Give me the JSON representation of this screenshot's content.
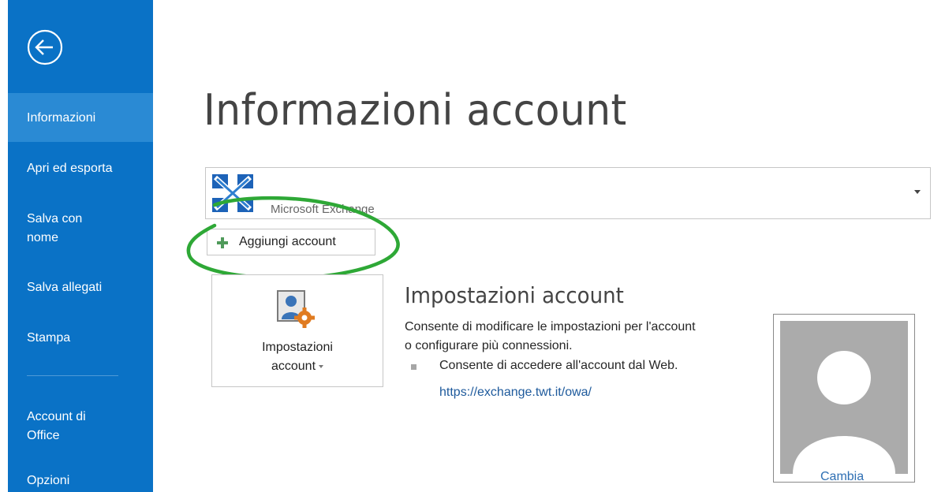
{
  "sidebar": {
    "back_icon": "back-arrow-icon",
    "items": [
      {
        "label": "Informazioni",
        "active": true
      },
      {
        "label": "Apri ed esporta",
        "active": false
      },
      {
        "label": "Salva con",
        "label2": "nome",
        "active": false
      },
      {
        "label": "Salva allegati",
        "active": false
      },
      {
        "label": "Stampa",
        "active": false
      },
      {
        "label": "Account di",
        "label2": "Office",
        "active": false
      },
      {
        "label": "Opzioni",
        "active": false
      }
    ],
    "background_color": "#0a72c6",
    "active_color": "#2a8ad4"
  },
  "main": {
    "title": "Informazioni account",
    "account_selector": {
      "value": "Microsoft Exchange",
      "icon": "exchange-logo-icon"
    },
    "add_account_button": {
      "label": "Aggiungi account",
      "icon": "plus-icon"
    },
    "settings_tile": {
      "line1": "Impostazioni",
      "line2": "account",
      "icon": "account-settings-icon"
    },
    "section": {
      "heading": "Impostazioni account",
      "description_line1": "Consente di modificare le impostazioni per l'account",
      "description_line2": "o configurare più connessioni.",
      "bullet": "Consente di accedere all'account dal Web.",
      "link": "https://exchange.twt.it/owa/"
    },
    "profile": {
      "change_label": "Cambia",
      "photo_icon": "default-avatar-icon"
    },
    "annotation_color": "#2ea836"
  }
}
